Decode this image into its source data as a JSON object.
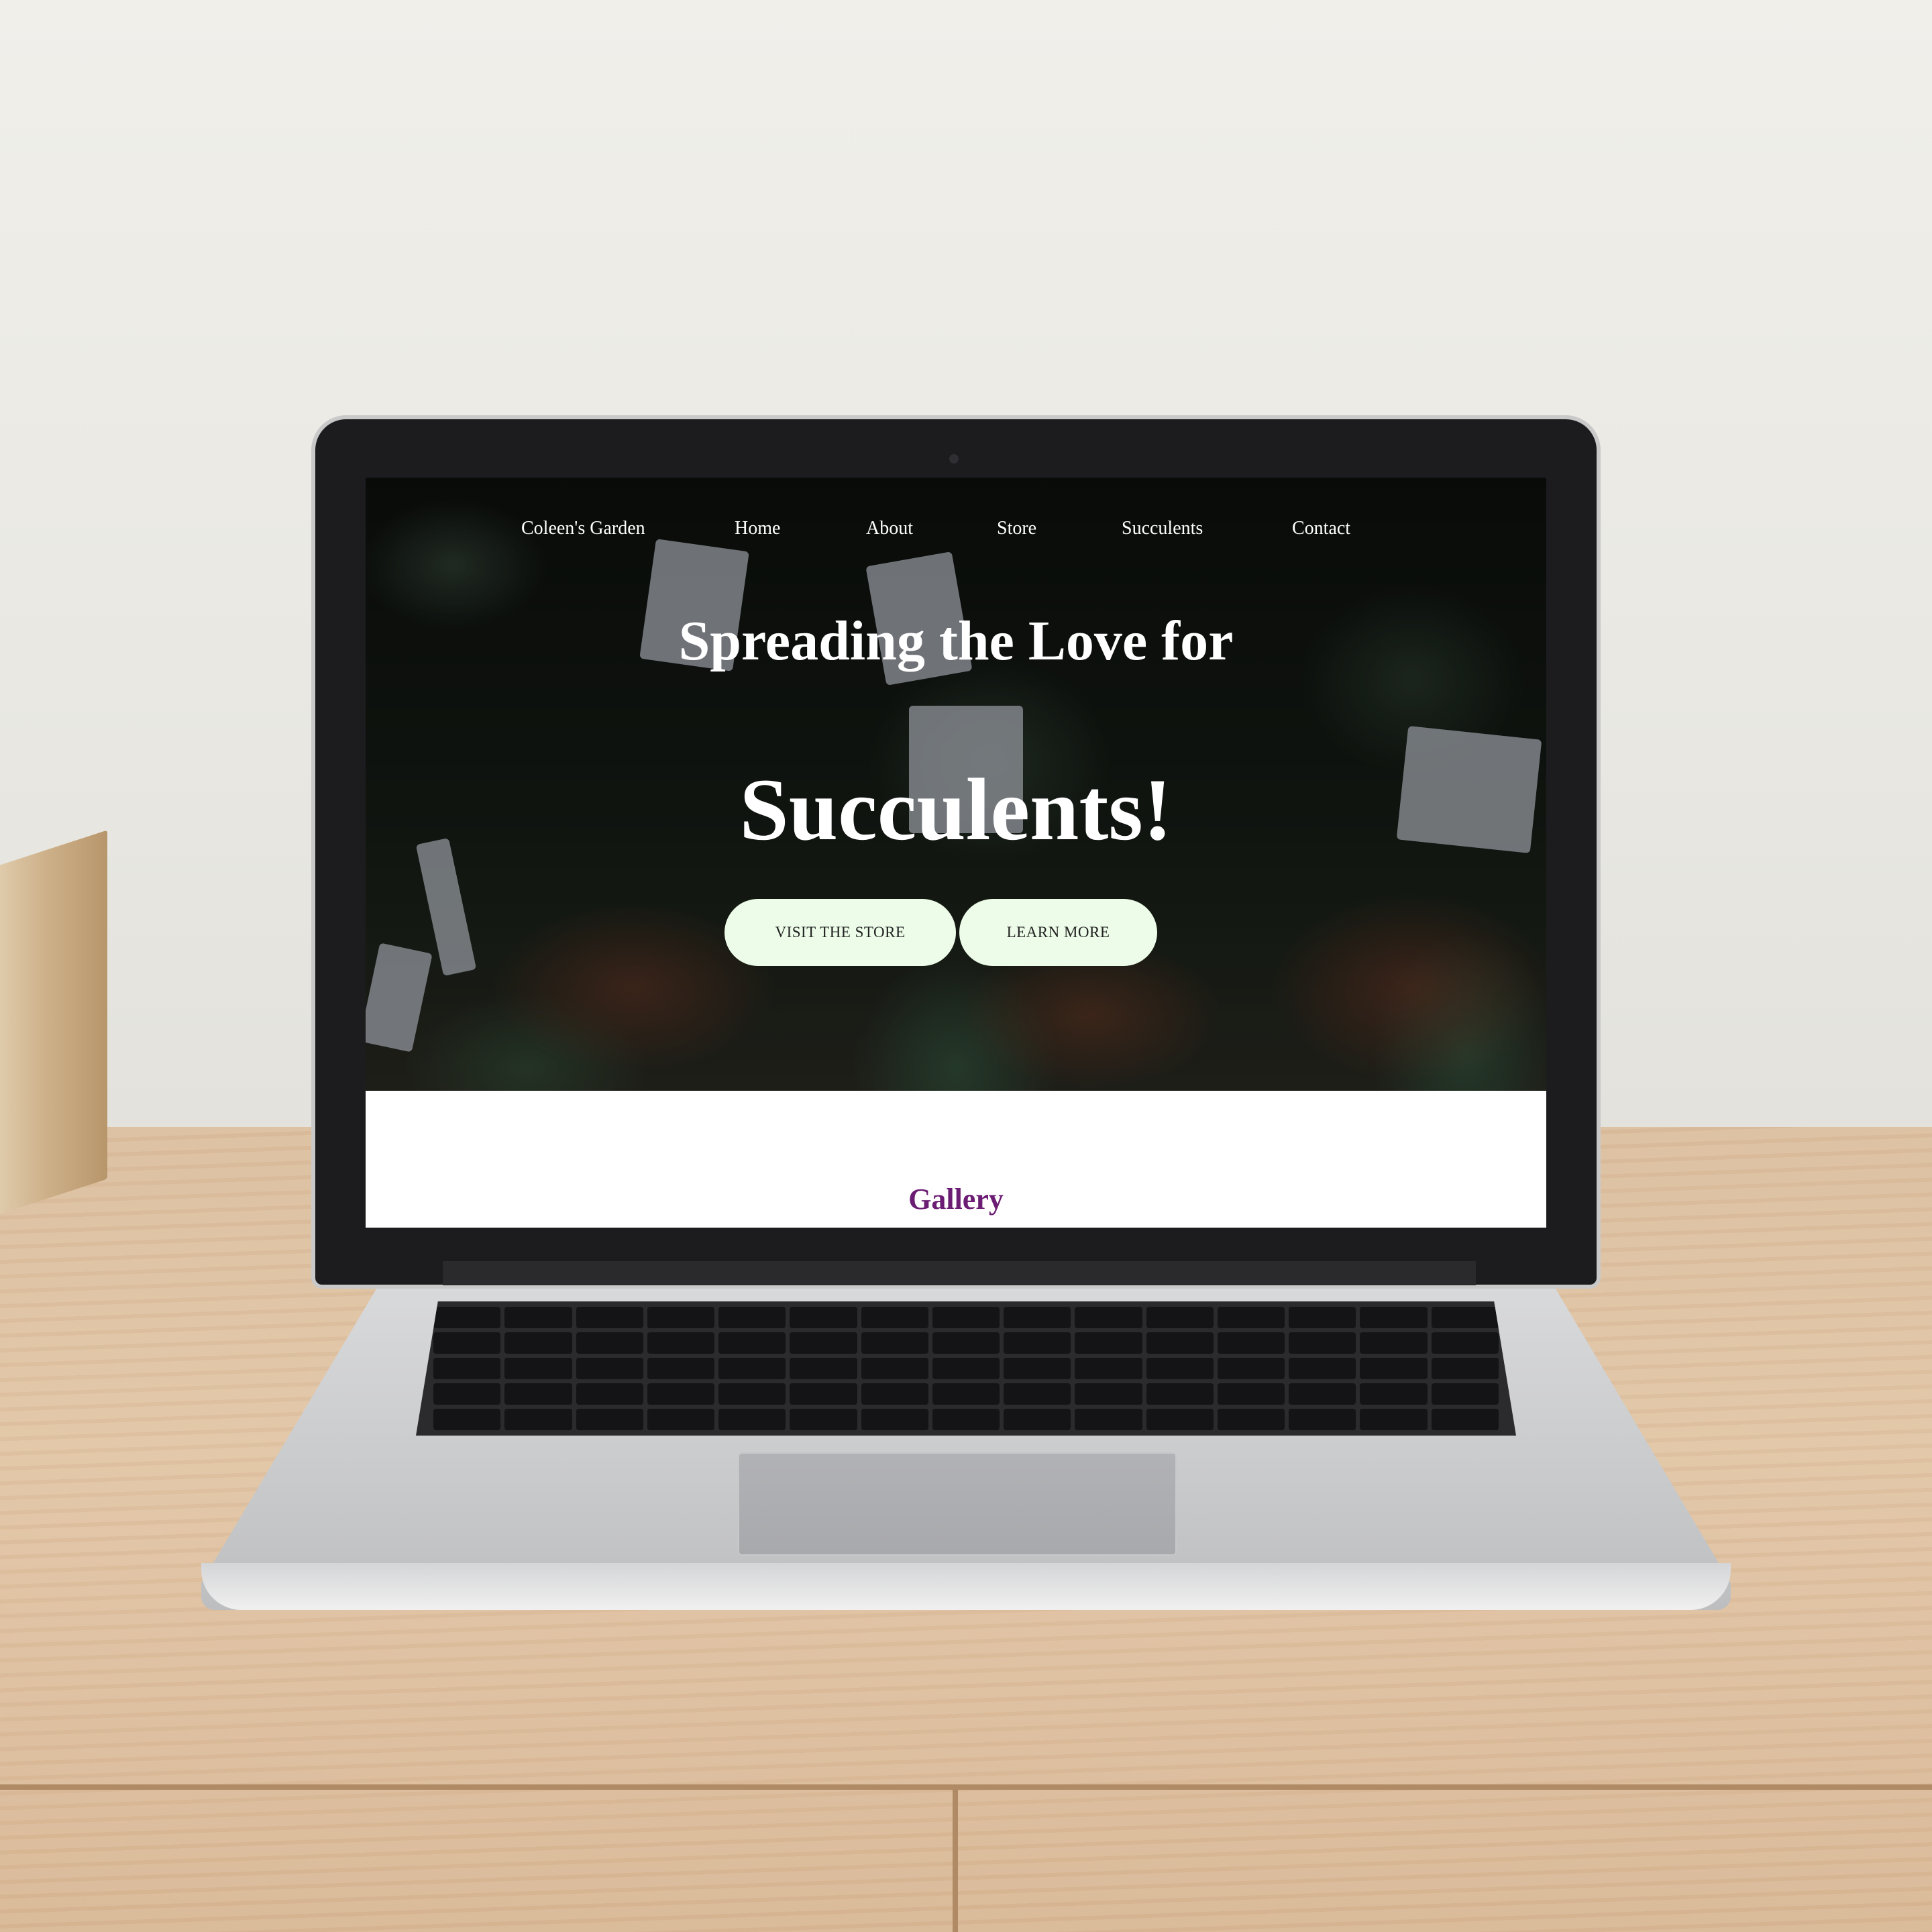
{
  "site": {
    "brand": "Coleen's Garden",
    "nav": [
      {
        "label": "Home"
      },
      {
        "label": "About"
      },
      {
        "label": "Store"
      },
      {
        "label": "Succulents"
      },
      {
        "label": "Contact"
      }
    ]
  },
  "hero": {
    "headline_line1": "Spreading the Love for",
    "headline_line2": "Succulents!",
    "buttons": [
      {
        "label": "VISIT THE STORE"
      },
      {
        "label": "LEARN MORE"
      }
    ],
    "button_color": "#ecfce8"
  },
  "gallery": {
    "title": "Gallery",
    "title_color": "#6b1c73"
  }
}
